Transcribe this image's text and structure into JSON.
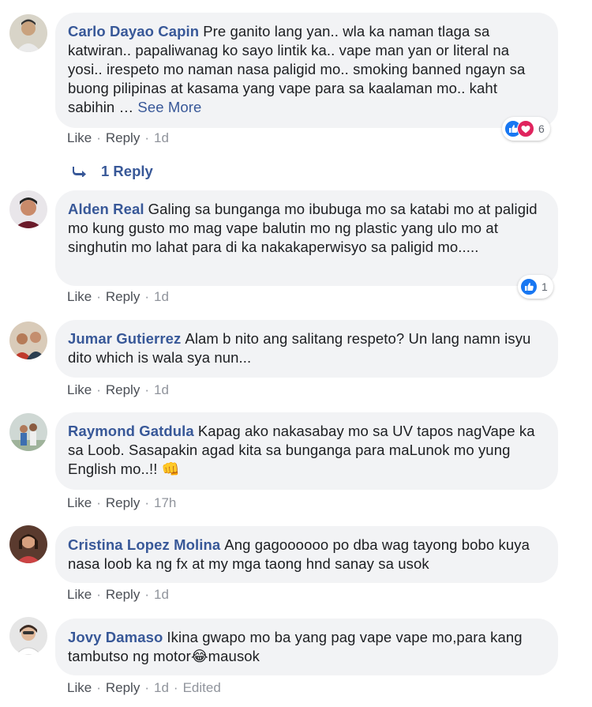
{
  "colors": {
    "link": "#385898",
    "bubble": "#f2f3f5",
    "meta": "#90949c",
    "like_blue": "#1877f2",
    "love_red": "#e0245e"
  },
  "actions_labels": {
    "like": "Like",
    "reply": "Reply",
    "dot": "·",
    "edited": "Edited"
  },
  "comments": [
    {
      "author": "Carlo Dayao Capin",
      "text": "Pre ganito lang yan.. wla ka naman tlaga sa katwiran.. papaliwanag ko sayo lintik ka.. vape man yan or literal na yosi.. irespeto mo naman nasa paligid mo.. smoking banned ngayn sa buong pilipinas at kasama yang vape para sa kaalaman mo.. kaht sabihin …",
      "see_more": "See More",
      "time": "1d",
      "reactions": {
        "icons": [
          "like-icon",
          "love-icon"
        ],
        "count": "6"
      },
      "replies_label": "1 Reply"
    },
    {
      "author": "Alden Real",
      "text": "Galing sa bunganga mo ibubuga mo sa katabi mo at paligid mo kung gusto mo mag vape balutin mo ng plastic yang ulo mo at singhutin mo lahat para di ka nakakaperwisyo sa paligid mo.....",
      "time": "1d",
      "reactions": {
        "icons": [
          "like-icon"
        ],
        "count": "1"
      }
    },
    {
      "author": "Jumar Gutierrez",
      "text": "Alam b nito ang salitang respeto? Un lang namn isyu dito which is wala sya nun...",
      "time": "1d"
    },
    {
      "author": "Raymond Gatdula",
      "text": "Kapag ako nakasabay mo sa UV tapos nagVape ka sa Loob. Sasapakin agad kita sa bunganga para maLunok mo yung English mo..!! 👊",
      "time": "17h"
    },
    {
      "author": "Cristina Lopez Molina",
      "text": "Ang gagoooooo po dba wag tayong bobo kuya nasa loob ka ng fx at my mga taong hnd sanay sa usok",
      "time": "1d"
    },
    {
      "author": "Jovy Damaso",
      "text": "Ikina gwapo mo ba yang pag vape vape mo,para kang tambutso ng motor😂mausok",
      "time": "1d",
      "edited": true
    }
  ]
}
